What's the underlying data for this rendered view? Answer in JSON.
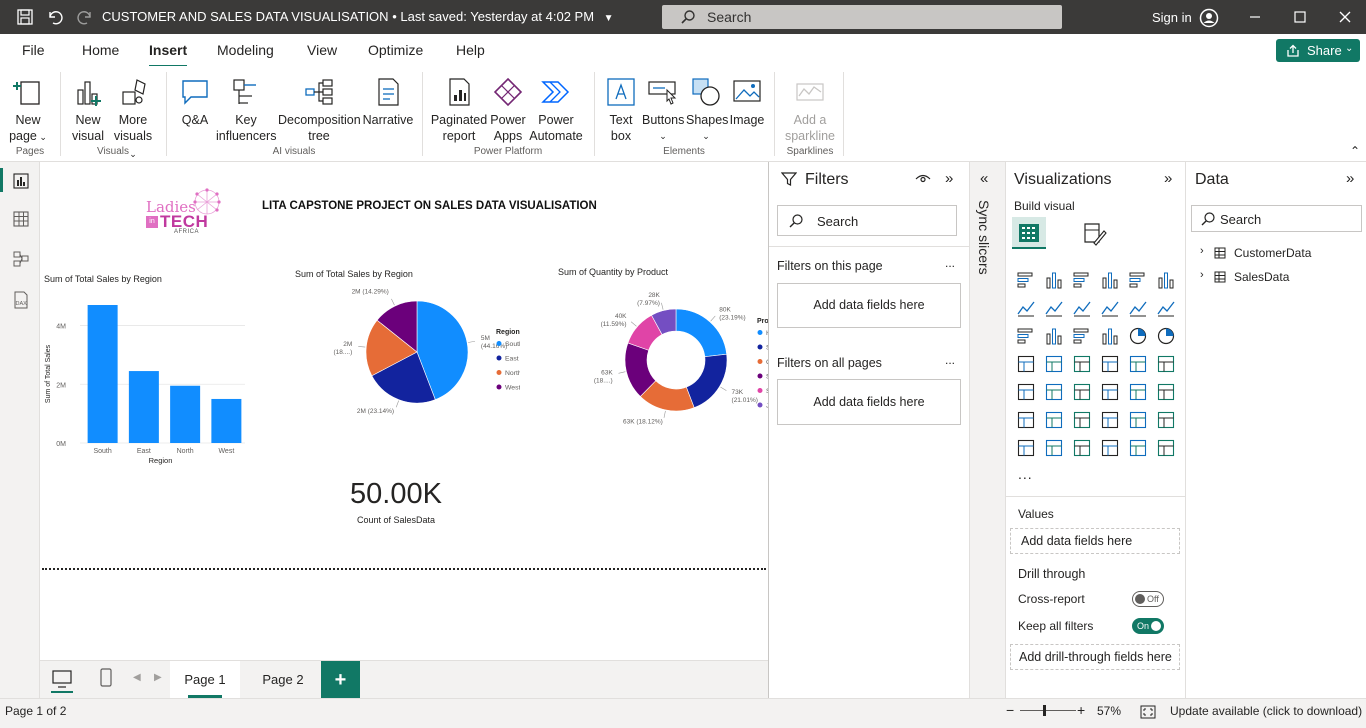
{
  "titlebar": {
    "title": "CUSTOMER AND SALES DATA VISUALISATION",
    "saved": "Last saved: Yesterday at 4:02 PM",
    "search_placeholder": "Search",
    "signin": "Sign in"
  },
  "menu": {
    "tabs": [
      "File",
      "Home",
      "Insert",
      "Modeling",
      "View",
      "Optimize",
      "Help"
    ],
    "active": "Insert",
    "share": "Share"
  },
  "ribbon": {
    "new_page": [
      "New",
      "page"
    ],
    "new_visual": [
      "New",
      "visual"
    ],
    "more_visuals": [
      "More",
      "visuals"
    ],
    "qa": "Q&A",
    "key_influencers": [
      "Key",
      "influencers"
    ],
    "decomposition": [
      "Decomposition",
      "tree"
    ],
    "narrative": "Narrative",
    "paginated": [
      "Paginated",
      "report"
    ],
    "power_apps": [
      "Power",
      "Apps"
    ],
    "power_automate": [
      "Power",
      "Automate"
    ],
    "text_box": [
      "Text",
      "box"
    ],
    "buttons": "Buttons",
    "shapes": "Shapes",
    "image": "Image",
    "sparkline": [
      "Add a",
      "sparkline"
    ],
    "groups": {
      "pages": "Pages",
      "visuals": "Visuals",
      "ai": "AI visuals",
      "power": "Power Platform",
      "elements": "Elements",
      "sparklines": "Sparklines"
    }
  },
  "report": {
    "logo": {
      "line1": "Ladies",
      "line2": "TECH",
      "prefix": "in",
      "line3": "AFRICA"
    },
    "title": "LITA CAPSTONE PROJECT ON SALES DATA VISUALISATION",
    "card_value": "50.00K",
    "card_label": "Count of SalesData"
  },
  "chart_data": [
    {
      "type": "bar",
      "title": "Sum of Total Sales by Region",
      "xlabel": "Region",
      "ylabel": "Sum of Total Sales",
      "categories": [
        "South",
        "East",
        "North",
        "West"
      ],
      "values": [
        4.7,
        2.45,
        1.95,
        1.5
      ],
      "ylim": [
        0,
        4.7
      ],
      "yticks": [
        {
          "v": 0,
          "label": "0M"
        },
        {
          "v": 2,
          "label": "2M"
        },
        {
          "v": 4,
          "label": "4M"
        }
      ],
      "color": "#118DFF"
    },
    {
      "type": "pie",
      "title": "Sum of Total Sales by Region",
      "legend_title": "Region",
      "slices": [
        {
          "name": "South",
          "value": 44.16,
          "color": "#118DFF",
          "label": "5M",
          "pct": "(44.16%)"
        },
        {
          "name": "East",
          "value": 23.14,
          "color": "#12239E",
          "label": "2M (23.14%)",
          "pct": ""
        },
        {
          "name": "North",
          "value": 18.41,
          "color": "#E66C37",
          "label": "2M",
          "pct": "(18....)"
        },
        {
          "name": "West",
          "value": 14.29,
          "color": "#6B007B",
          "label": "2M (14.29%)",
          "pct": ""
        }
      ]
    },
    {
      "type": "donut",
      "title": "Sum of Quantity by Product",
      "legend_title": "Product",
      "slices": [
        {
          "name": "Hat",
          "value": 23.19,
          "color": "#118DFF",
          "label": "80K",
          "pct": "(23.19%)"
        },
        {
          "name": "Shoes",
          "value": 21.01,
          "color": "#12239E",
          "label": "73K",
          "pct": "(21.01%)"
        },
        {
          "name": "Gloves",
          "value": 18.12,
          "color": "#E66C37",
          "label": "63K (18.12%)",
          "pct": ""
        },
        {
          "name": "Shirt",
          "value": 18.12,
          "color": "#6B007B",
          "label": "63K",
          "pct": "(18....)"
        },
        {
          "name": "Socks",
          "value": 11.59,
          "color": "#E044A7",
          "label": "40K",
          "pct": "(11.59%)"
        },
        {
          "name": "Jacket",
          "value": 7.97,
          "color": "#744EC2",
          "label": "28K",
          "pct": "(7.97%)"
        }
      ]
    }
  ],
  "filters": {
    "title": "Filters",
    "search_placeholder": "Search",
    "this_page": "Filters on this page",
    "all_pages": "Filters on all pages",
    "add_here": "Add data fields here",
    "more": "..."
  },
  "sync": {
    "label": "Sync slicers"
  },
  "viz": {
    "title": "Visualizations",
    "build": "Build visual",
    "more": "...",
    "values": "Values",
    "add_here": "Add data fields here",
    "drill": "Drill through",
    "cross_report": "Cross-report",
    "cross_state": "Off",
    "keep_filters": "Keep all filters",
    "keep_state": "On",
    "add_drill": "Add drill-through fields here"
  },
  "data": {
    "title": "Data",
    "search_placeholder": "Search",
    "tables": [
      "CustomerData",
      "SalesData"
    ]
  },
  "pages": {
    "tabs": [
      "Page 1",
      "Page 2"
    ],
    "active": "Page 1",
    "add": "+"
  },
  "status": {
    "page": "Page 1 of 2",
    "zoom": "57%",
    "update": "Update available (click to download)"
  },
  "colors": {
    "accent": "#117865",
    "bar": "#118DFF"
  }
}
